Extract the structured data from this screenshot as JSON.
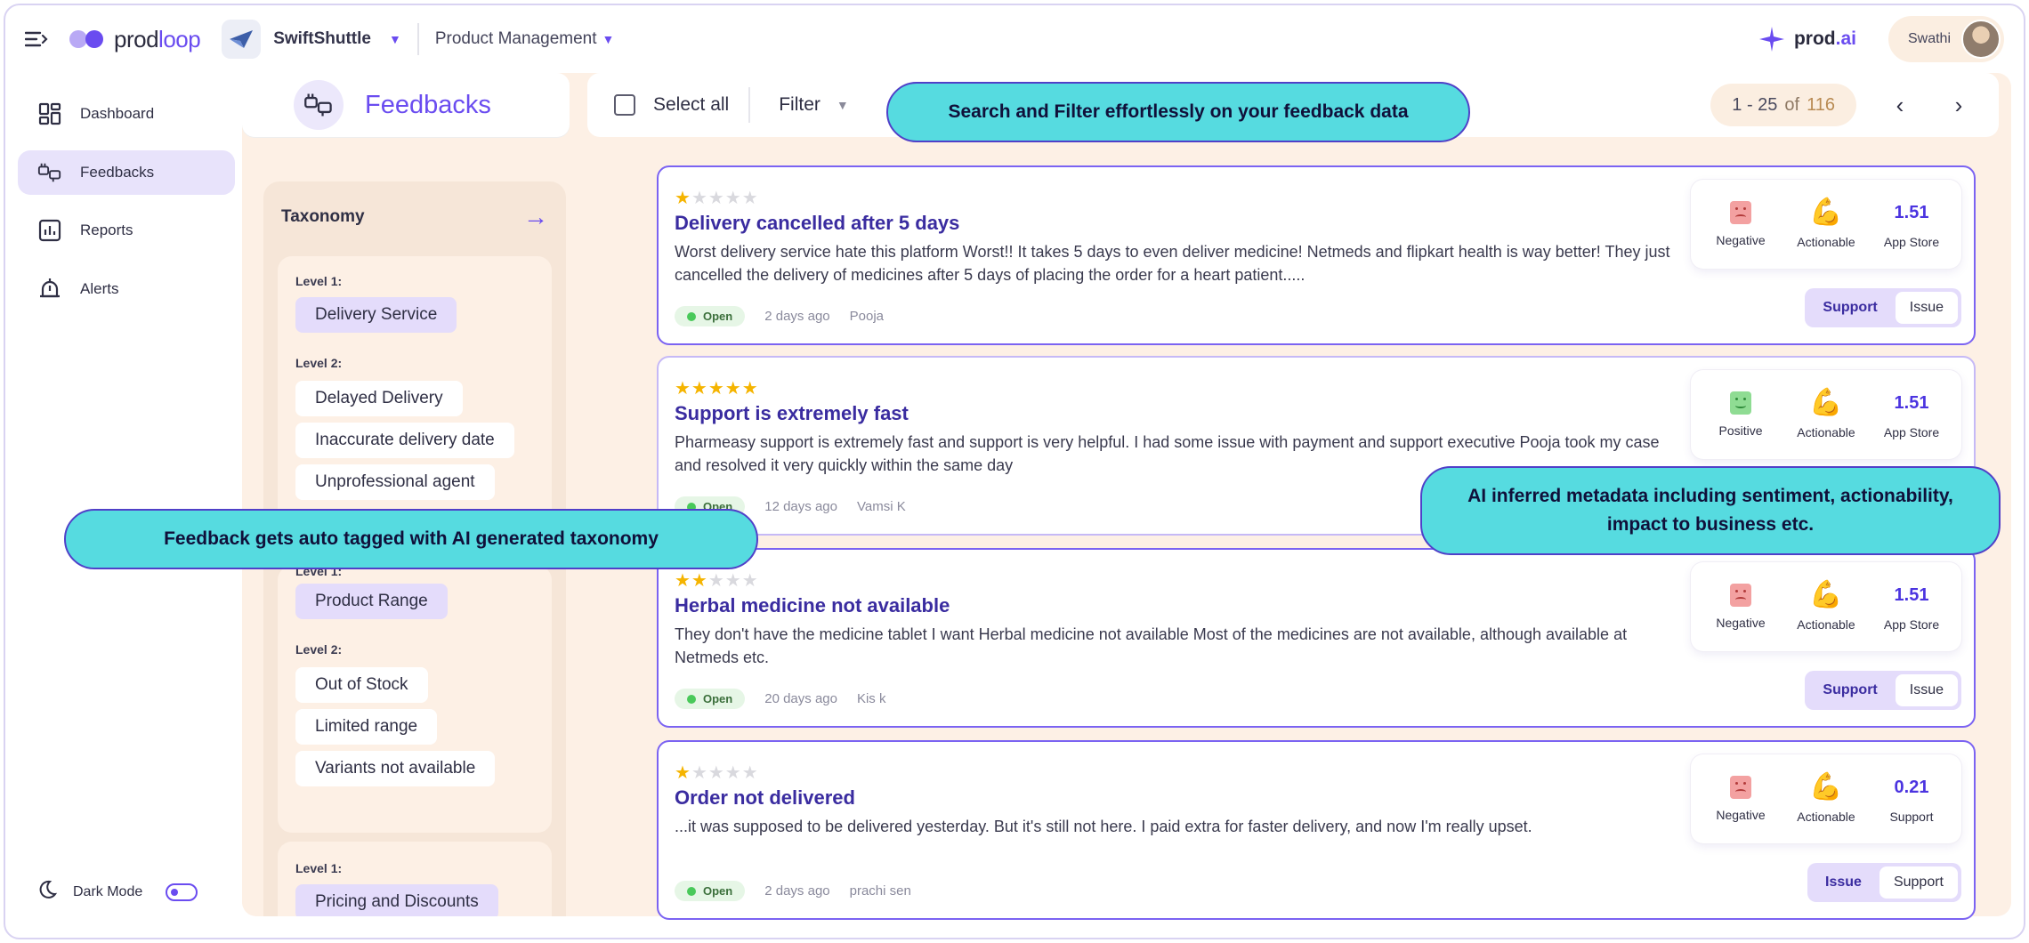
{
  "app": {
    "logo_text": "prod",
    "logo_text_accent": "loop"
  },
  "workspace": {
    "name": "SwiftShuttle",
    "section": "Product Management"
  },
  "top_right": {
    "ai_label": "prod",
    "ai_label_accent": ".ai",
    "user_name": "Swathi"
  },
  "sidebar": {
    "items": [
      {
        "label": "Dashboard",
        "icon": "dashboard-icon"
      },
      {
        "label": "Feedbacks",
        "icon": "feedbacks-icon",
        "active": true
      },
      {
        "label": "Reports",
        "icon": "reports-icon"
      },
      {
        "label": "Alerts",
        "icon": "alerts-icon"
      }
    ],
    "dark_mode_label": "Dark Mode"
  },
  "page": {
    "title": "Feedbacks"
  },
  "toolbar": {
    "select_all": "Select all",
    "filter": "Filter",
    "pager_range": "1 - 25",
    "pager_of": "of",
    "pager_total": "116",
    "prev": "‹",
    "next": "›"
  },
  "taxonomy": {
    "title": "Taxonomy",
    "groups": [
      {
        "level1_label": "Level 1:",
        "level1": "Delivery Service",
        "level2_label": "Level 2:",
        "level2": [
          "Delayed Delivery",
          "Inaccurate delivery date",
          "Unprofessional agent"
        ]
      },
      {
        "level1_label": "Level 1:",
        "level1": "Product Range",
        "level2_label": "Level 2:",
        "level2": [
          "Out of Stock",
          "Limited range",
          "Variants not available"
        ]
      },
      {
        "level1_label": "Level 1:",
        "level1": "Pricing and Discounts"
      }
    ]
  },
  "feedbacks": [
    {
      "rating": 1,
      "title": "Delivery cancelled after 5 days",
      "body": "Worst delivery service hate this platform Worst!! It takes 5 days to even deliver medicine! Netmeds and flipkart health is way better! They just cancelled the delivery of medicines after 5 days of placing the order for a heart patient.....",
      "status": "Open",
      "time": "2 days ago",
      "author": "Pooja",
      "sentiment": "Negative",
      "actionability": "Actionable",
      "score": "1.51",
      "source": "App Store",
      "tags": [
        "Support",
        "Issue"
      ]
    },
    {
      "rating": 5,
      "title": "Support is extremely fast",
      "body": "Pharmeasy support is extremely fast and support is very helpful. I had some issue with payment and support executive Pooja took my case and resolved it very quickly within the same day",
      "status": "Open",
      "time": "12 days ago",
      "author": "Vamsi  K",
      "sentiment": "Positive",
      "actionability": "Actionable",
      "score": "1.51",
      "source": "App Store",
      "tags": []
    },
    {
      "rating": 2,
      "title": "Herbal medicine not available",
      "body": "They don't have the medicine tablet I want Herbal medicine not available Most of the medicines are not available, although available at Netmeds etc.",
      "status": "Open",
      "time": "20 days ago",
      "author": "Kis k",
      "sentiment": "Negative",
      "actionability": "Actionable",
      "score": "1.51",
      "source": "App Store",
      "tags": [
        "Support",
        "Issue"
      ]
    },
    {
      "rating": 1,
      "title": "Order not delivered",
      "body": "...it was supposed to be delivered yesterday. But it's still not here. I paid extra for faster delivery, and now I'm really upset.",
      "status": "Open",
      "time": "2 days ago",
      "author": "prachi sen",
      "sentiment": "Negative",
      "actionability": "Actionable",
      "score": "0.21",
      "source": "Support",
      "tags": [
        "Issue",
        "Support"
      ]
    }
  ],
  "callouts": {
    "search": "Search and Filter effortlessly on your feedback data",
    "taxonomy": "Feedback gets auto tagged with AI generated taxonomy",
    "metadata": "AI inferred metadata including sentiment, actionability, impact to business etc."
  },
  "colors": {
    "accent": "#6a4cf0",
    "callout": "#56dbe0",
    "panel": "#fdf0e5"
  }
}
